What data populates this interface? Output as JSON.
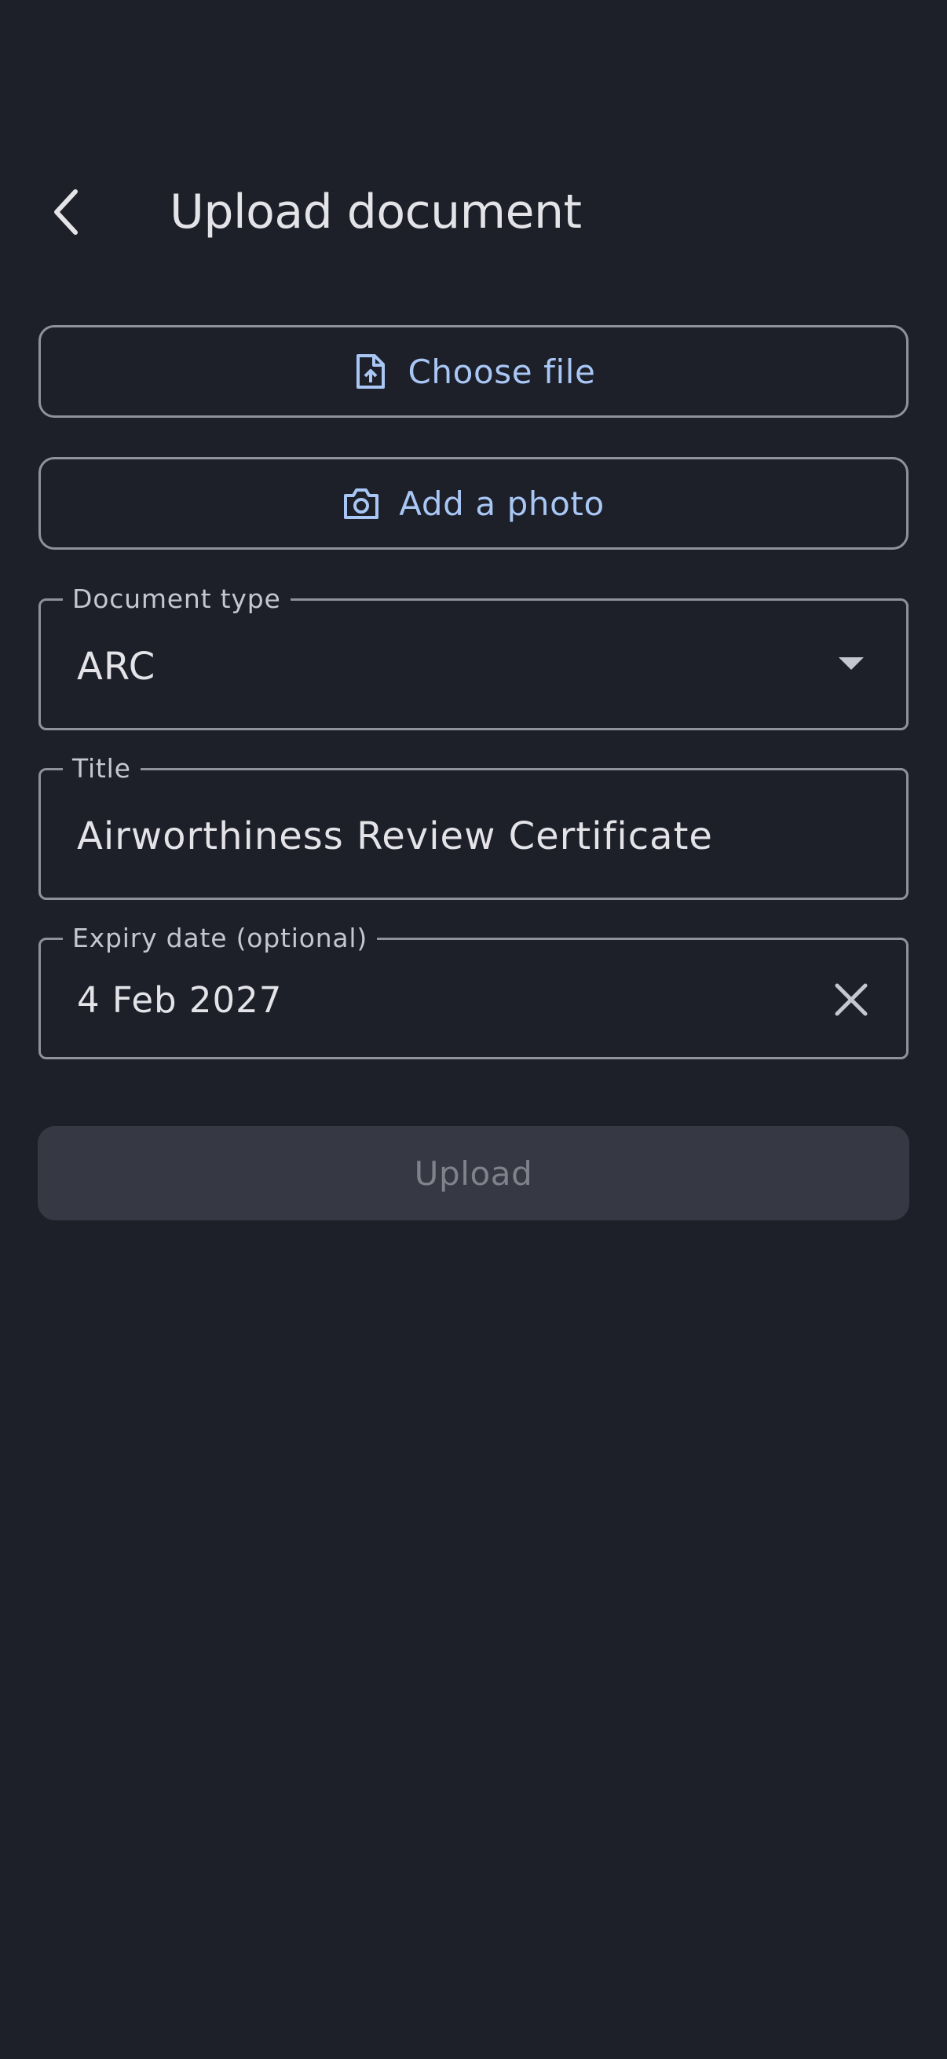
{
  "header": {
    "title": "Upload document",
    "back_icon": "chevron-left-icon"
  },
  "actions": {
    "choose_file_label": "Choose file",
    "choose_file_icon": "file-upload-icon",
    "add_photo_label": "Add a photo",
    "add_photo_icon": "camera-icon"
  },
  "form": {
    "document_type": {
      "label": "Document type",
      "value": "ARC",
      "icon": "dropdown-arrow-icon"
    },
    "title": {
      "label": "Title",
      "value": "Airworthiness Review Certificate"
    },
    "expiry_date": {
      "label": "Expiry date (optional)",
      "value": "4 Feb 2027",
      "clear_icon": "close-icon"
    }
  },
  "submit": {
    "label": "Upload",
    "state": "disabled"
  },
  "colors": {
    "background": "#1d1f29",
    "accent": "#a9c7f5",
    "outline": "#8f919b",
    "disabled_bg": "#363944",
    "disabled_text": "#80828b"
  }
}
